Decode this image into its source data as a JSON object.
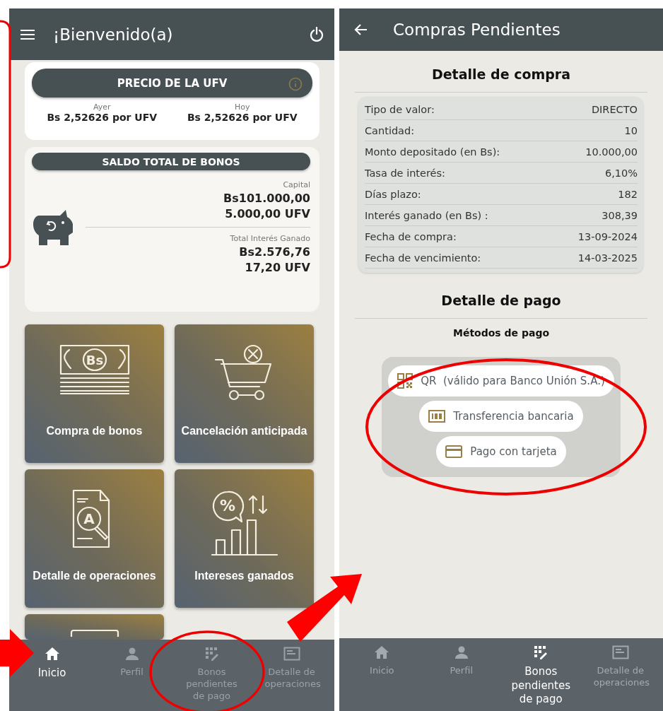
{
  "home": {
    "title": "¡Bienvenido(a)",
    "ufv": {
      "title": "PRECIO DE LA UFV",
      "yesterday_label": "Ayer",
      "yesterday_value": "Bs 2,52626 por UFV",
      "today_label": "Hoy",
      "today_value": "Bs 2,52626 por UFV"
    },
    "balance": {
      "title": "SALDO TOTAL DE BONOS",
      "capital_label": "Capital",
      "capital_bs": "Bs101.000,00",
      "capital_ufv": "5.000,00 UFV",
      "interest_label": "Total Interés Ganado",
      "interest_bs": "Bs2.576,76",
      "interest_ufv": "17,20 UFV"
    },
    "tiles": [
      {
        "kind": "money",
        "symbol": "Bs",
        "label": "Compra de bonos"
      },
      {
        "kind": "cart",
        "label": "Cancelación anticipada"
      },
      {
        "kind": "document",
        "symbol": "A",
        "label": "Detalle de operaciones"
      },
      {
        "kind": "chart",
        "symbol": "%",
        "label": "Intereses ganados"
      },
      {
        "kind": "partial"
      }
    ],
    "nav": [
      {
        "kind": "home",
        "label": "Inicio",
        "selected": true
      },
      {
        "kind": "person",
        "label": "Perfil",
        "selected": false
      },
      {
        "kind": "grid",
        "label": "Bonos pendientes de pago",
        "selected": false
      },
      {
        "kind": "list",
        "label": "Detalle de operaciones",
        "selected": false
      }
    ]
  },
  "pending": {
    "title": "Compras Pendientes",
    "purchase_title": "Detalle de compra",
    "rows": [
      {
        "label": "Tipo de valor:",
        "value": "DIRECTO"
      },
      {
        "label": "Cantidad:",
        "value": "10"
      },
      {
        "label": "Monto depositado (en Bs):",
        "value": "10.000,00"
      },
      {
        "label": "Tasa de interés:",
        "value": "6,10%"
      },
      {
        "label": "Días plazo:",
        "value": "182"
      },
      {
        "label": "Interés ganado (en Bs) :",
        "value": "308,39"
      },
      {
        "label": "Fecha de compra:",
        "value": "13-09-2024"
      },
      {
        "label": "Fecha de vencimiento:",
        "value": "14-03-2025"
      }
    ],
    "payment_title": "Detalle de pago",
    "methods_title": "Métodos de pago",
    "methods": [
      {
        "kind": "qr",
        "label": "QR  (válido para Banco Unión S.A.)"
      },
      {
        "kind": "bank",
        "label": "Transferencia bancaria"
      },
      {
        "kind": "card",
        "label": "Pago con tarjeta"
      }
    ],
    "nav": [
      {
        "kind": "home",
        "label": "Inicio",
        "selected": false
      },
      {
        "kind": "person",
        "label": "Perfil",
        "selected": false
      },
      {
        "kind": "grid",
        "label": "Bonos pendientes de pago",
        "selected": true
      },
      {
        "kind": "list",
        "label": "Detalle de operaciones",
        "selected": false
      }
    ]
  }
}
